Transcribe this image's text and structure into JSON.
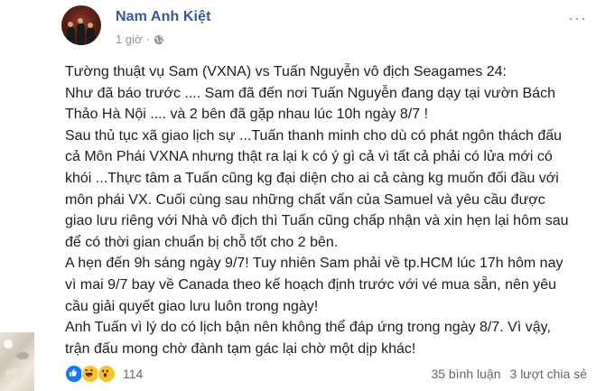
{
  "post": {
    "author": "Nam Anh Kiệt",
    "time": "1 giờ",
    "separator": "·",
    "privacy_icon": "globe-icon",
    "more_label": "···",
    "lines": [
      "Tường thuật vụ Sam (VXNA) vs Tuấn Nguyễn vô địch Seagames 24:",
      "Như đã báo trước .... Sam đã đến nơi Tuấn Nguyễn đang dạy tại vườn Bách",
      "Thảo Hà Nội .... và 2 bên đã gặp nhau lúc 10h ngày 8/7 !",
      "Sau thủ tục xã giao lịch sự ...Tuấn thanh minh cho dù có phát ngôn thách đấu",
      "cả Môn Phái VXNA nhưng thật ra lại k có ý gì cả vì tất cả phải có lửa mới có",
      "khói ...Thực tâm a Tuấn cũng kg đại diện cho ai cả càng kg muốn đối đầu với",
      "môn phái VX. Cuối cùng sau những chất vấn của Samuel và yêu cầu được",
      "giao lưu riêng với Nhà vô địch thì Tuấn cũng chấp nhận và xin hẹn lại hôm sau",
      "để có thời gian chuẩn bị chỗ tốt cho 2 bên.",
      "A hẹn đến 9h sáng ngày 9/7! Tuy nhiên Sam phải về tp.HCM lúc 17h hôm nay",
      "vì mai 9/7 bay về Canada theo kế hoạch định trước với vé mua sẵn, nên yêu",
      "cầu giải quyết giao lưu luôn trong ngày!",
      "Anh Tuấn vì lý do có lịch bận nên không thể đáp ứng trong ngày 8/7. Vì vậy,",
      "trận đấu mong chờ đành tạm gác lại chờ một dịp khác!"
    ]
  },
  "footer": {
    "reactions": [
      "like-icon",
      "haha-icon",
      "wow-icon"
    ],
    "reaction_count": "114",
    "comments": "35 bình luận",
    "shares": "3 lượt chia sẻ"
  },
  "colors": {
    "author": "#385898",
    "meta": "#90949c",
    "text": "#1c1e21",
    "like": "#1877f2",
    "emoji_yellow": "#f7c430"
  }
}
